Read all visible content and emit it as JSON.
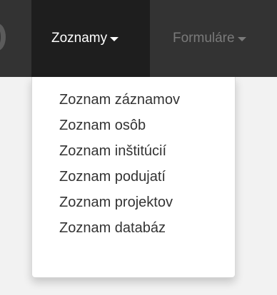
{
  "navbar": {
    "items": [
      {
        "label": "Zoznamy",
        "active": true
      },
      {
        "label": "Formuláre",
        "active": false
      }
    ]
  },
  "dropdown": {
    "items": [
      {
        "label": "Zoznam záznamov"
      },
      {
        "label": "Zoznam osôb"
      },
      {
        "label": "Zoznam inštitúcií"
      },
      {
        "label": "Zoznam podujatí"
      },
      {
        "label": "Zoznam projektov"
      },
      {
        "label": "Zoznam databáz"
      }
    ]
  },
  "colors": {
    "navbar_bg": "#333333",
    "active_bg": "#1e1e1e",
    "active_text": "#ffffff",
    "inactive_text": "#7a7a7a",
    "dropdown_text": "#333333"
  }
}
